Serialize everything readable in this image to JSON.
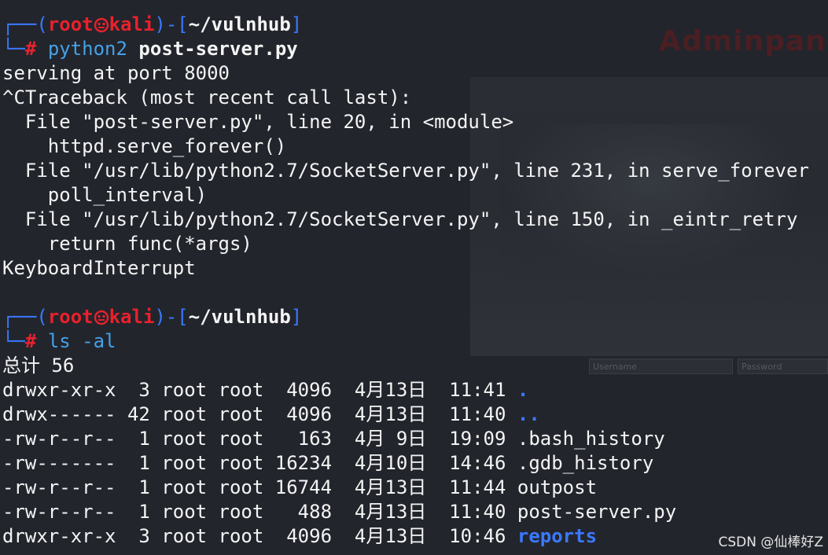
{
  "background": {
    "title": "Adminpanel",
    "username_placeholder": "Username",
    "password_placeholder": "Password"
  },
  "prompt": {
    "open": "┌──(",
    "user": "root",
    "host": "kali",
    "close": ")-[",
    "path": "~/vulnhub",
    "end": "]",
    "second_prefix": "└─",
    "hash": "#"
  },
  "commands": {
    "first_cmd": "python2",
    "first_arg": "post-server.py",
    "second_cmd": "ls -al"
  },
  "output1": [
    "serving at port 8000",
    "^CTraceback (most recent call last):",
    "  File \"post-server.py\", line 20, in <module>",
    "    httpd.serve_forever()",
    "  File \"/usr/lib/python2.7/SocketServer.py\", line 231, in serve_forever",
    "    poll_interval)",
    "  File \"/usr/lib/python2.7/SocketServer.py\", line 150, in _eintr_retry",
    "    return func(*args)",
    "KeyboardInterrupt"
  ],
  "listing": {
    "total": "总计 56",
    "rows": [
      {
        "meta": "drwxr-xr-x  3 root root  4096  4月13日  11:41 ",
        "name": "."
      },
      {
        "meta": "drwx------ 42 root root  4096  4月13日  11:40 ",
        "name": ".."
      },
      {
        "meta": "-rw-r--r--  1 root root   163  4月 9日  19:09 ",
        "name": ".bash_history"
      },
      {
        "meta": "-rw-------  1 root root 16234  4月10日  14:46 ",
        "name": ".gdb_history"
      },
      {
        "meta": "-rw-r--r--  1 root root 16744  4月13日  11:44 ",
        "name": "outpost"
      },
      {
        "meta": "-rw-r--r--  1 root root   488  4月13日  11:40 ",
        "name": "post-server.py"
      },
      {
        "meta": "drwxr-xr-x  3 root root  4096  4月13日  10:46 ",
        "name": "reports"
      }
    ]
  },
  "colors": {
    "background": "#22252c",
    "prompt_red": "#e8212c",
    "frame_blue": "#3b78ff",
    "command_cyan": "#45a1e8",
    "text": "#f4f4f4"
  },
  "watermark": "CSDN @仙棒好Z"
}
